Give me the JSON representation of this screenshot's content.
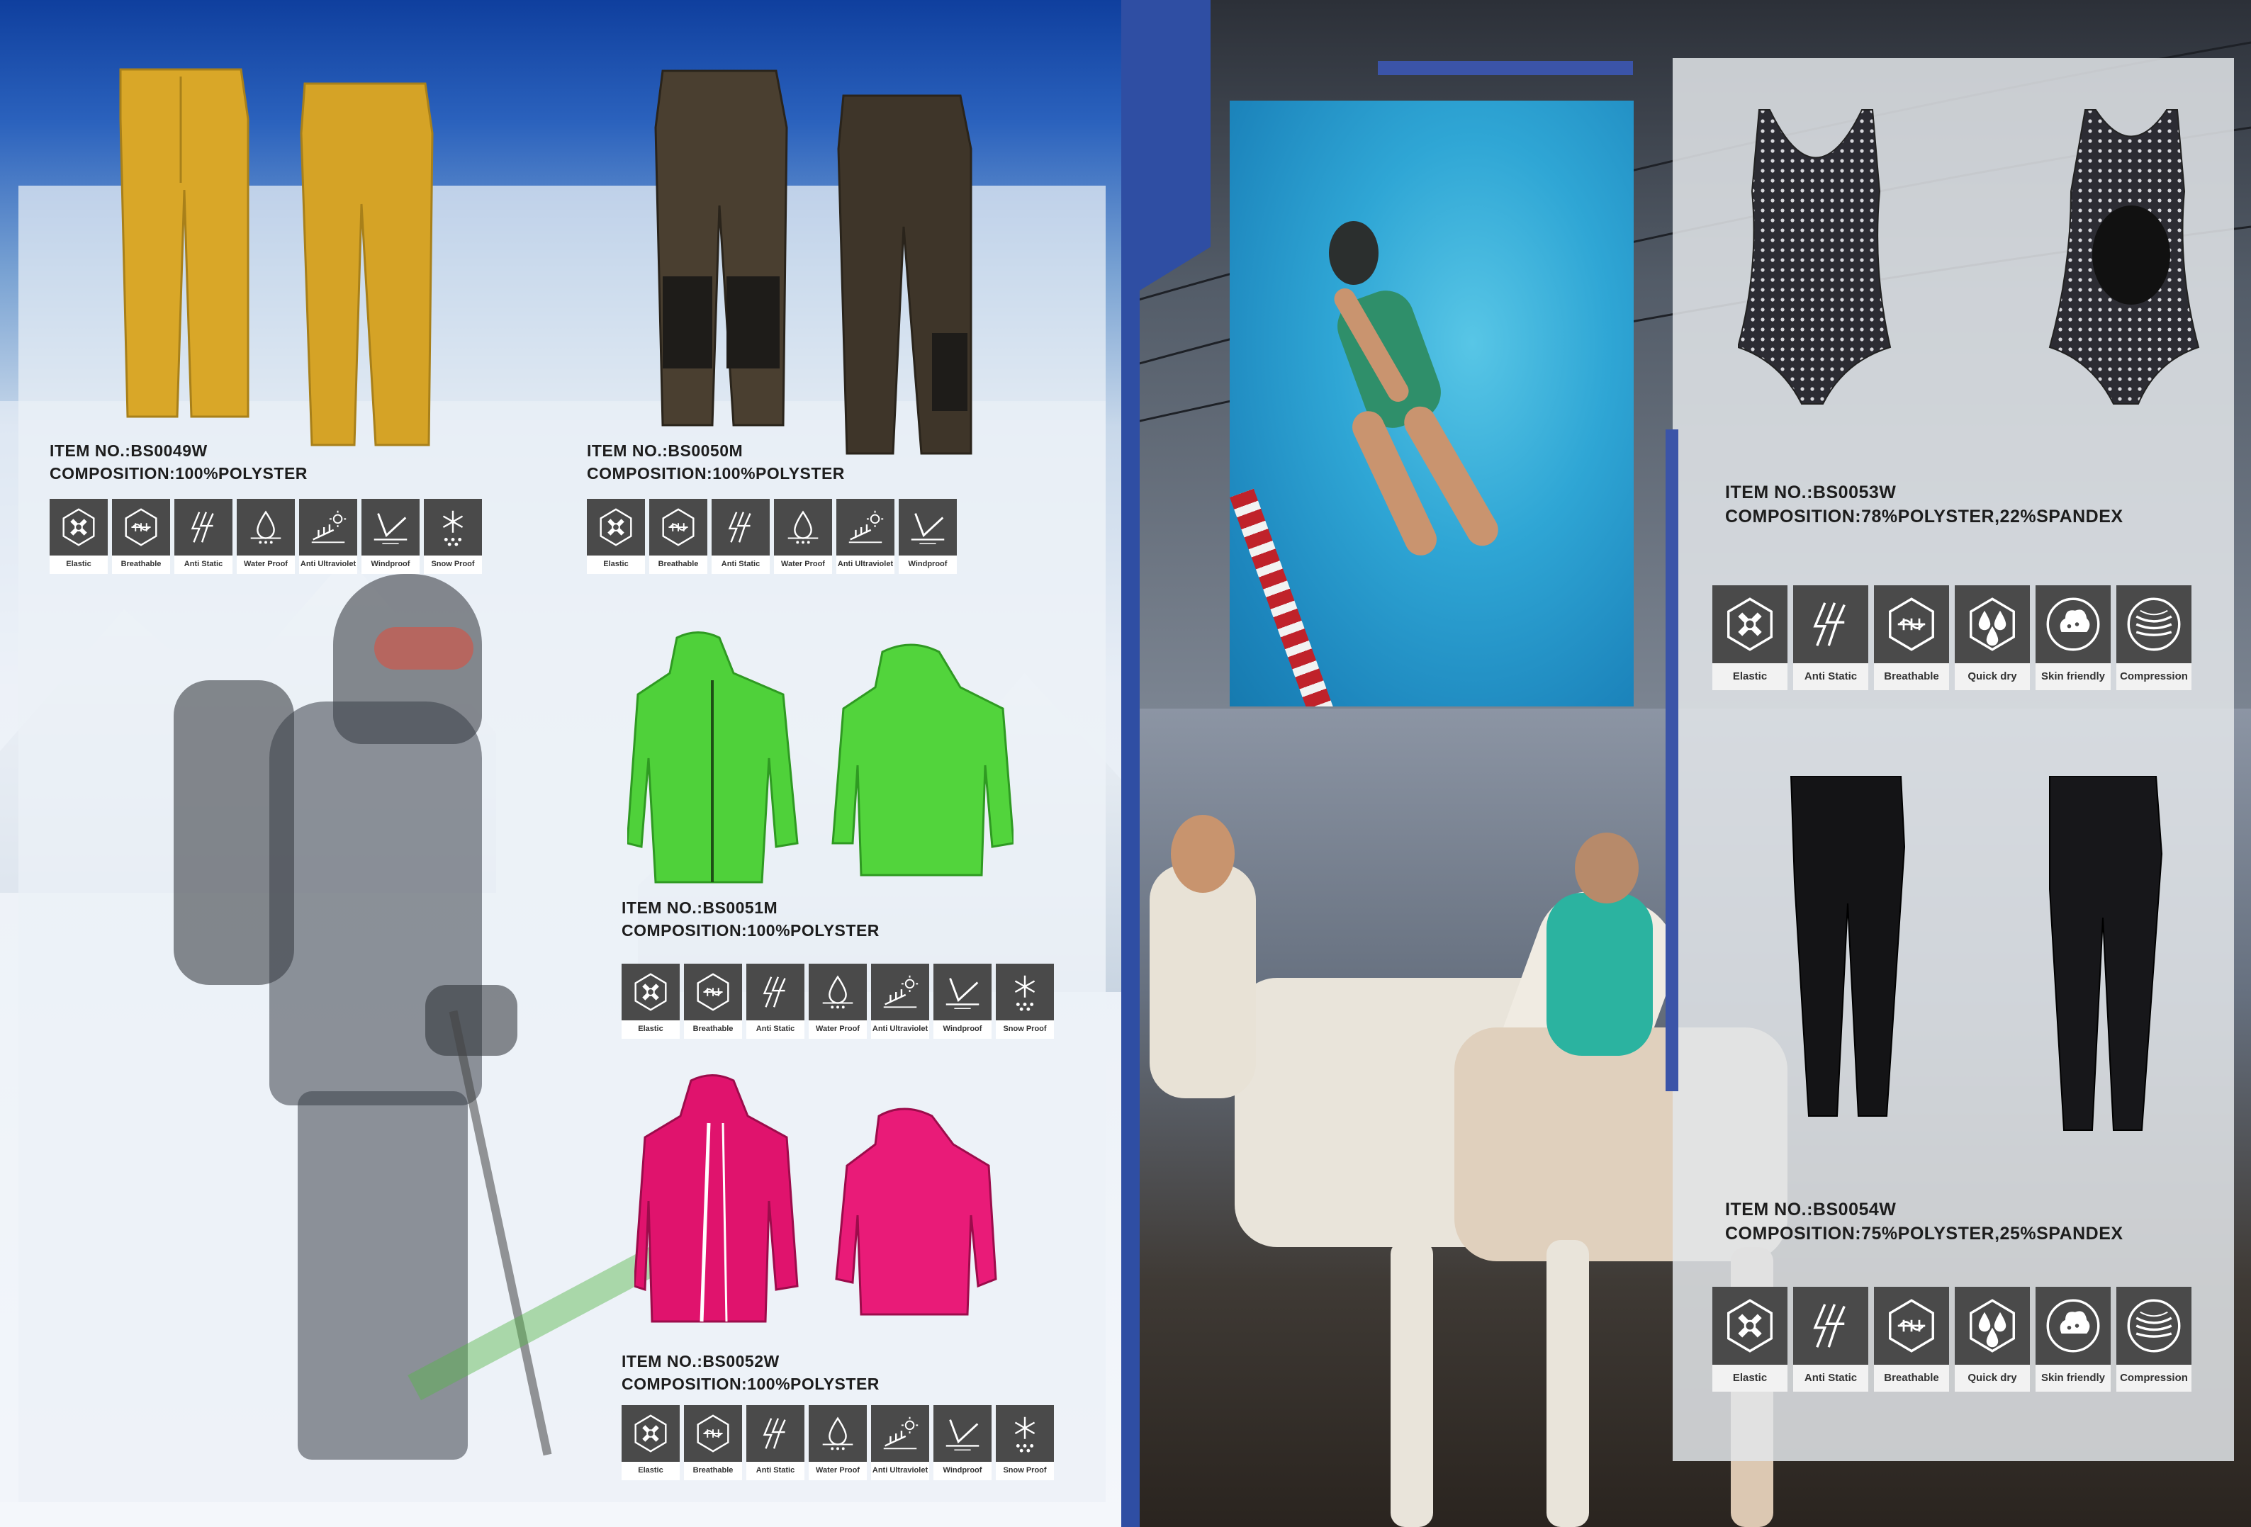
{
  "products": [
    {
      "item": "ITEM  NO.:BS0049W",
      "composition": "COMPOSITION:100%POLYSTER"
    },
    {
      "item": "ITEM  NO.:BS0050M",
      "composition": "COMPOSITION:100%POLYSTER"
    },
    {
      "item": "ITEM  NO.:BS0051M",
      "composition": "COMPOSITION:100%POLYSTER"
    },
    {
      "item": "ITEM  NO.:BS0052W",
      "composition": "COMPOSITION:100%POLYSTER"
    },
    {
      "item": "ITEM  NO.:BS0053W",
      "composition": "COMPOSITION:78%POLYSTER,22%SPANDEX"
    },
    {
      "item": "ITEM  NO.:BS0054W",
      "composition": "COMPOSITION:75%POLYSTER,25%SPANDEX"
    }
  ],
  "features": {
    "outdoor7": [
      {
        "label": "Elastic",
        "icon": "elastic-icon"
      },
      {
        "label": "Breathable",
        "icon": "breathable-icon"
      },
      {
        "label": "Anti Static",
        "icon": "anti-static-icon"
      },
      {
        "label": "Water Proof",
        "icon": "water-proof-icon"
      },
      {
        "label": "Anti Ultraviolet",
        "icon": "anti-ultraviolet-icon"
      },
      {
        "label": "Windproof",
        "icon": "windproof-icon"
      },
      {
        "label": "Snow Proof",
        "icon": "snow-proof-icon"
      }
    ],
    "outdoor6": [
      {
        "label": "Elastic",
        "icon": "elastic-icon"
      },
      {
        "label": "Breathable",
        "icon": "breathable-icon"
      },
      {
        "label": "Anti Static",
        "icon": "anti-static-icon"
      },
      {
        "label": "Water Proof",
        "icon": "water-proof-icon"
      },
      {
        "label": "Anti Ultraviolet",
        "icon": "anti-ultraviolet-icon"
      },
      {
        "label": "Windproof",
        "icon": "windproof-icon"
      }
    ],
    "sport6": [
      {
        "label": "Elastic",
        "icon": "elastic-icon"
      },
      {
        "label": "Anti Static",
        "icon": "anti-static-icon"
      },
      {
        "label": "Breathable",
        "icon": "breathable-icon"
      },
      {
        "label": "Quick dry",
        "icon": "quick-dry-icon"
      },
      {
        "label": "Skin friendly",
        "icon": "skin-friendly-icon"
      },
      {
        "label": "Compression",
        "icon": "compression-icon"
      }
    ]
  },
  "colors": {
    "accent_blue": "#2f4ea3",
    "icon_bg": "#4a4a4a",
    "yellow_pants": "#d9a728",
    "brown_pants": "#3e3529",
    "green_jacket": "#4fd13a",
    "pink_jacket": "#e0136d",
    "swimsuit": "#2c2c33"
  }
}
